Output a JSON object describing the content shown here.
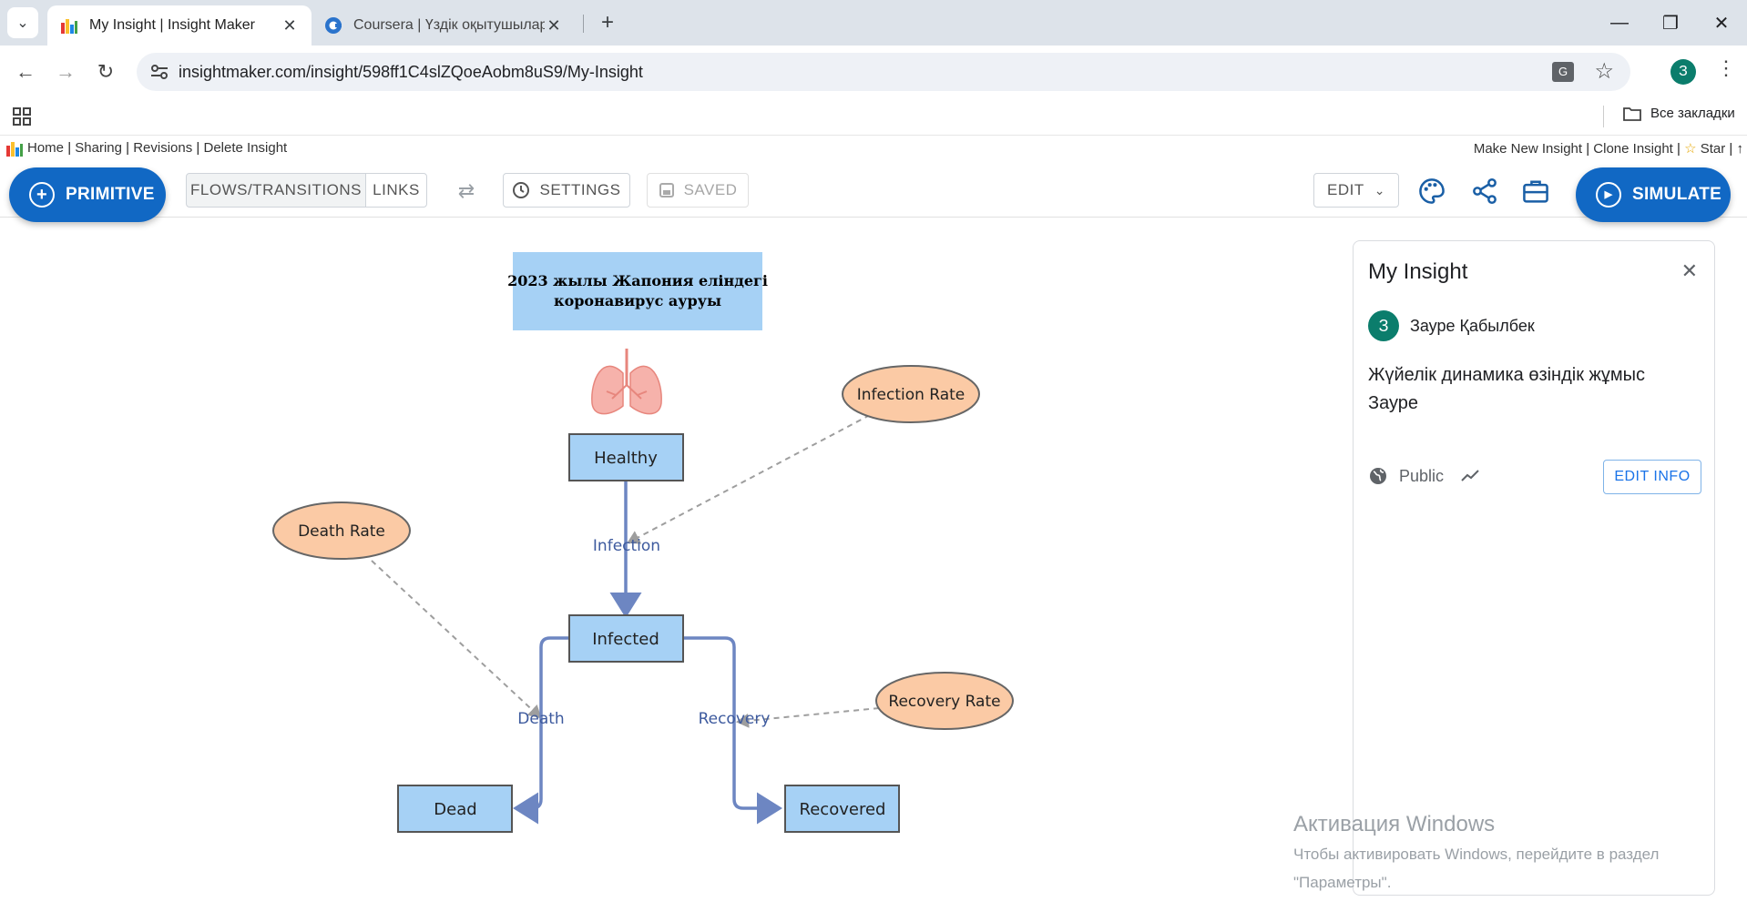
{
  "browser": {
    "tabs": [
      {
        "title": "My Insight | Insight Maker",
        "active": true
      },
      {
        "title": "Coursera | Үздік оқытушылардан",
        "active": false
      }
    ],
    "url": "insightmaker.com/insight/598ff1C4slZQoeAobm8uS9/My-Insight",
    "profile_initial": "З",
    "bookmarks_label": "Все закладки"
  },
  "im_links": {
    "left": [
      "Home",
      "Sharing",
      "Revisions",
      "Delete Insight"
    ],
    "right": [
      "Make New Insight",
      "Clone Insight",
      "Star"
    ],
    "separator": " | "
  },
  "toolbar": {
    "primitive_label": "PRIMITIVE",
    "flows_label": "FLOWS/TRANSITIONS",
    "links_label": "LINKS",
    "settings_label": "SETTINGS",
    "saved_label": "SAVED",
    "edit_label": "EDIT",
    "simulate_label": "SIMULATE"
  },
  "model": {
    "title_line1": "2023 жылы Жапония еліндегі",
    "title_line2": "коронавирус ауруы",
    "stocks": {
      "healthy": "Healthy",
      "infected": "Infected",
      "dead": "Dead",
      "recovered": "Recovered"
    },
    "variables": {
      "infection_rate": "Infection Rate",
      "death_rate": "Death Rate",
      "recovery_rate": "Recovery Rate"
    },
    "flows": {
      "infection": "Infection",
      "death": "Death",
      "recovery": "Recovery"
    },
    "colors": {
      "stock_fill": "#a6d1f5",
      "variable_fill": "#fbcaa5",
      "flow_color": "#6d86c2",
      "title_fill": "#a6d1f5"
    }
  },
  "panel": {
    "title": "My Insight",
    "avatar_initial": "З",
    "user": "Зауре Қабылбек",
    "description": "Жүйелік динамика өзіндік жұмыс Зауре",
    "visibility": "Public",
    "edit_info_label": "EDIT INFO"
  },
  "windows_activation": {
    "title": "Активация Windows",
    "line1": "Чтобы активировать Windows, перейдите в раздел",
    "line2": "\"Параметры\"."
  }
}
